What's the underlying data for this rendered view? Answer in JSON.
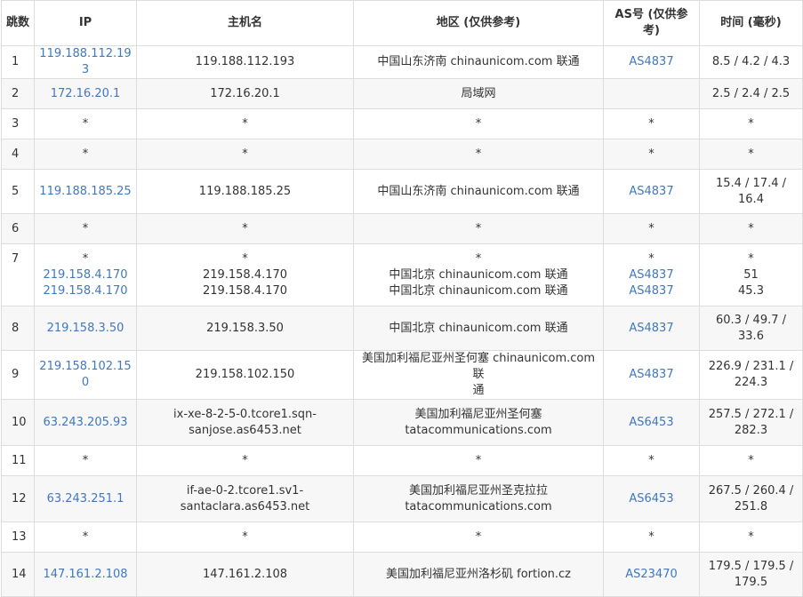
{
  "headers": {
    "hop": "跳数",
    "ip": "IP",
    "hostname": "主机名",
    "region": "地区 (仅供参考)",
    "as": "AS号 (仅供参考)",
    "time": "时间 (毫秒)"
  },
  "colors": {
    "link": "#4078c0",
    "border": "#dddddd",
    "stripe": "#f7f7f7"
  },
  "rows": [
    {
      "hop": "1",
      "ip": [
        "119.188.112.193"
      ],
      "host": [
        "119.188.112.193"
      ],
      "region": [
        "中国山东济南 chinaunicom.com 联通"
      ],
      "as": [
        "AS4837"
      ],
      "time": [
        "8.5 / 4.2 / 4.3"
      ]
    },
    {
      "hop": "2",
      "ip": [
        "172.16.20.1"
      ],
      "host": [
        "172.16.20.1"
      ],
      "region": [
        "局域网"
      ],
      "as": [
        ""
      ],
      "time": [
        "2.5 / 2.4 / 2.5"
      ]
    },
    {
      "hop": "3",
      "ip": [
        "*"
      ],
      "host": [
        "*"
      ],
      "region": [
        "*"
      ],
      "as": [
        "*"
      ],
      "time": [
        "*"
      ]
    },
    {
      "hop": "4",
      "ip": [
        "*"
      ],
      "host": [
        "*"
      ],
      "region": [
        "*"
      ],
      "as": [
        "*"
      ],
      "time": [
        "*"
      ]
    },
    {
      "hop": "5",
      "ip": [
        "119.188.185.25"
      ],
      "host": [
        "119.188.185.25"
      ],
      "region": [
        "中国山东济南 chinaunicom.com 联通"
      ],
      "as": [
        "AS4837"
      ],
      "time": [
        "15.4 / 17.4 /",
        "16.4"
      ]
    },
    {
      "hop": "6",
      "ip": [
        "*"
      ],
      "host": [
        "*"
      ],
      "region": [
        "*"
      ],
      "as": [
        "*"
      ],
      "time": [
        "*"
      ]
    },
    {
      "hop": "7",
      "ip": [
        "*",
        "219.158.4.170",
        "219.158.4.170"
      ],
      "host": [
        "*",
        "219.158.4.170",
        "219.158.4.170"
      ],
      "region": [
        "*",
        "中国北京 chinaunicom.com 联通",
        "中国北京 chinaunicom.com 联通"
      ],
      "as": [
        "*",
        "AS4837",
        "AS4837"
      ],
      "time": [
        "*",
        "51",
        "45.3"
      ]
    },
    {
      "hop": "8",
      "ip": [
        "219.158.3.50"
      ],
      "host": [
        "219.158.3.50"
      ],
      "region": [
        "中国北京 chinaunicom.com 联通"
      ],
      "as": [
        "AS4837"
      ],
      "time": [
        "60.3 / 49.7 /",
        "33.6"
      ]
    },
    {
      "hop": "9",
      "ip": [
        "219.158.102.150"
      ],
      "host": [
        "219.158.102.150"
      ],
      "region": [
        "美国加利福尼亚州圣何塞 chinaunicom.com 联",
        "通"
      ],
      "as": [
        "AS4837"
      ],
      "time": [
        "226.9 / 231.1 /",
        "224.3"
      ]
    },
    {
      "hop": "10",
      "ip": [
        "63.243.205.93"
      ],
      "host": [
        "ix-xe-8-2-5-0.tcore1.sqn-",
        "sanjose.as6453.net"
      ],
      "region": [
        "美国加利福尼亚州圣何塞",
        "tatacommunications.com"
      ],
      "as": [
        "AS6453"
      ],
      "time": [
        "257.5 / 272.1 /",
        "282.3"
      ]
    },
    {
      "hop": "11",
      "ip": [
        "*"
      ],
      "host": [
        "*"
      ],
      "region": [
        "*"
      ],
      "as": [
        "*"
      ],
      "time": [
        "*"
      ]
    },
    {
      "hop": "12",
      "ip": [
        "63.243.251.1"
      ],
      "host": [
        "if-ae-0-2.tcore1.sv1-",
        "santaclara.as6453.net"
      ],
      "region": [
        "美国加利福尼亚州圣克拉拉",
        "tatacommunications.com"
      ],
      "as": [
        "AS6453"
      ],
      "time": [
        "267.5 / 260.4 /",
        "251.8"
      ]
    },
    {
      "hop": "13",
      "ip": [
        "*"
      ],
      "host": [
        "*"
      ],
      "region": [
        "*"
      ],
      "as": [
        "*"
      ],
      "time": [
        "*"
      ]
    },
    {
      "hop": "14",
      "ip": [
        "147.161.2.108"
      ],
      "host": [
        "147.161.2.108"
      ],
      "region": [
        "美国加利福尼亚州洛杉矶 fortion.cz"
      ],
      "as": [
        "AS23470"
      ],
      "time": [
        "179.5 / 179.5 /",
        "179.5"
      ]
    }
  ]
}
